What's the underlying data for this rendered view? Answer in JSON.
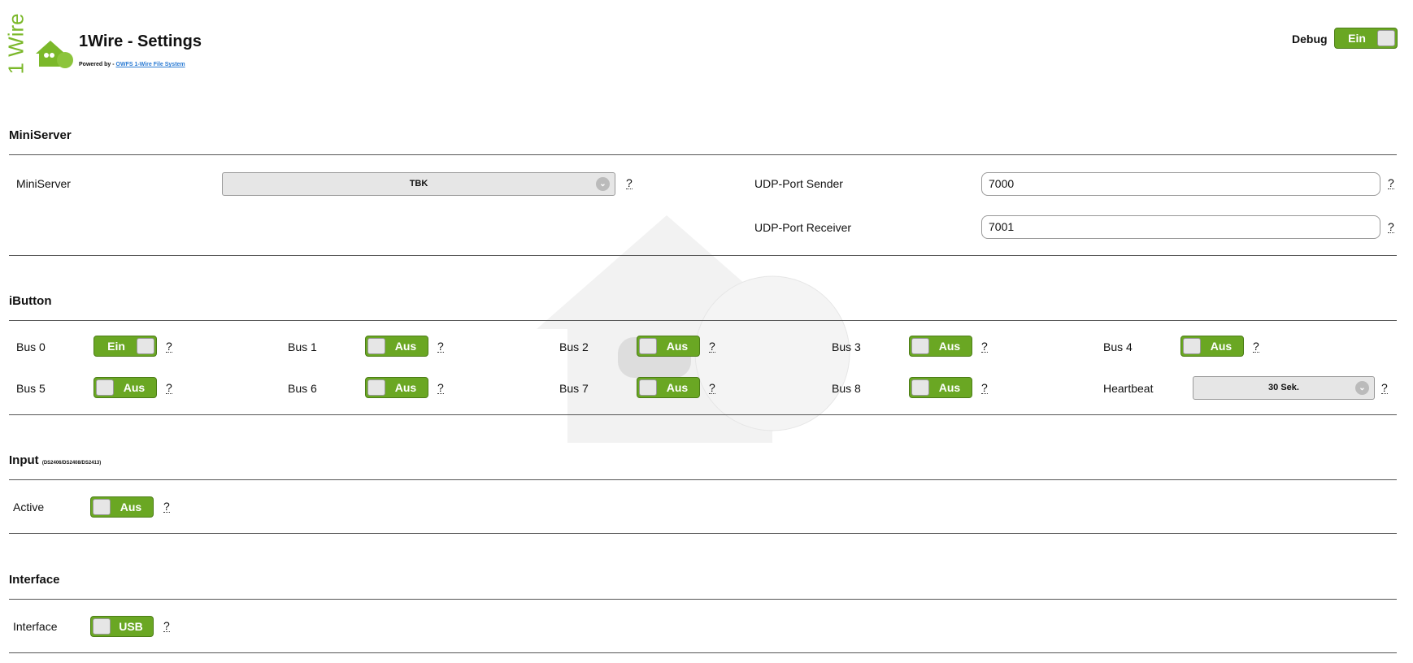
{
  "header": {
    "logo_text": "1 Wire",
    "title": "1Wire - Settings",
    "powered_by": "Powered by - ",
    "powered_link": "OWFS 1-Wire File System",
    "debug_label": "Debug",
    "debug_state": "Ein"
  },
  "miniserver": {
    "heading": "MiniServer",
    "label": "MiniServer",
    "value": "TBK",
    "udp_sender_label": "UDP-Port Sender",
    "udp_sender": "7000",
    "udp_receiver_label": "UDP-Port Receiver",
    "udp_receiver": "7001"
  },
  "ibutton": {
    "heading": "iButton",
    "buses": [
      {
        "label": "Bus 0",
        "state": "Ein"
      },
      {
        "label": "Bus 1",
        "state": "Aus"
      },
      {
        "label": "Bus 2",
        "state": "Aus"
      },
      {
        "label": "Bus 3",
        "state": "Aus"
      },
      {
        "label": "Bus 4",
        "state": "Aus"
      },
      {
        "label": "Bus 5",
        "state": "Aus"
      },
      {
        "label": "Bus 6",
        "state": "Aus"
      },
      {
        "label": "Bus 7",
        "state": "Aus"
      },
      {
        "label": "Bus 8",
        "state": "Aus"
      }
    ],
    "heartbeat_label": "Heartbeat",
    "heartbeat": "30 Sek."
  },
  "input": {
    "heading": "Input",
    "subtitle": "(DS2406/DS2408/DS2413)",
    "active_label": "Active",
    "active_state": "Aus"
  },
  "interface": {
    "heading": "Interface",
    "label": "Interface",
    "state": "USB"
  },
  "help": "?",
  "colors": {
    "accent": "#6aa723"
  }
}
